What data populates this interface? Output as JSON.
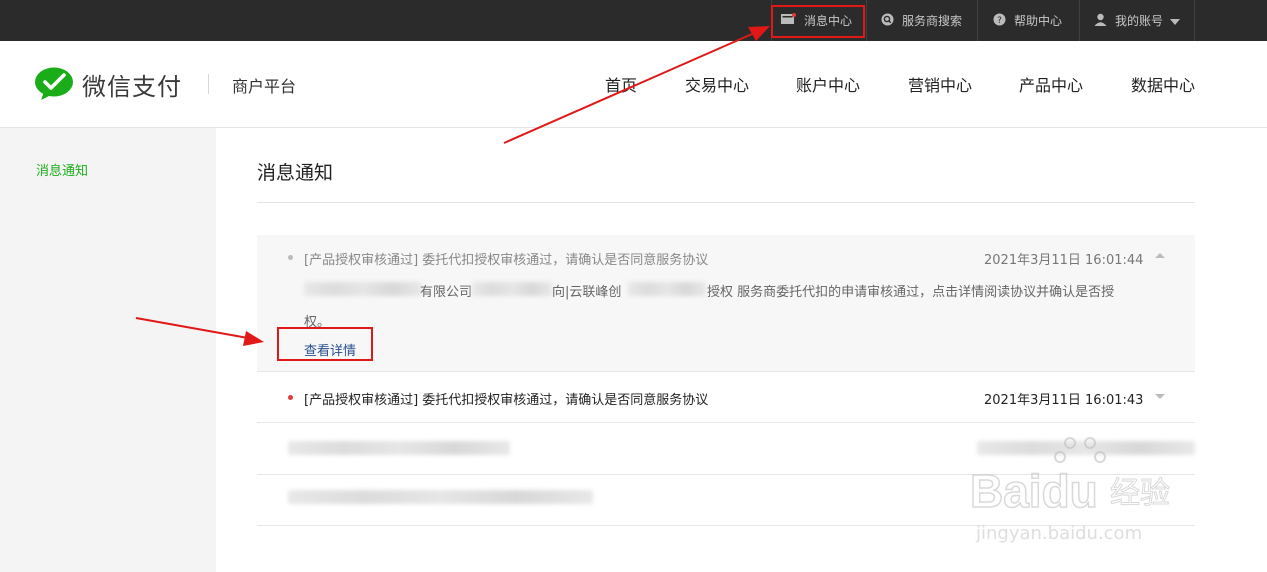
{
  "topbar": {
    "message_center": "消息中心",
    "provider_search": "服务商搜索",
    "help_center": "帮助中心",
    "my_account": "我的账号"
  },
  "brand": {
    "name": "微信支付",
    "subtitle": "商户平台",
    "accent": "#1aad19"
  },
  "nav": [
    "首页",
    "交易中心",
    "账户中心",
    "营销中心",
    "产品中心",
    "数据中心"
  ],
  "sidebar": {
    "items": [
      {
        "label": "消息通知"
      }
    ]
  },
  "main": {
    "title": "消息通知"
  },
  "messages": [
    {
      "title": "[产品授权审核通过] 委托代扣授权审核通过，请确认是否同意服务协议",
      "time": "2021年3月11日 16:01:44",
      "body_part1": "有限公司",
      "body_part2": "向|云联峰创",
      "body_part3": "授权 服务商委托代扣的申请审核通过，点击详情阅读协议并确认是否授",
      "body_line2": "权。",
      "detail_link": "查看详情",
      "expanded": true,
      "unread": false
    },
    {
      "title": "[产品授权审核通过] 委托代扣授权审核通过，请确认是否同意服务协议",
      "time": "2021年3月11日 16:01:43",
      "expanded": false,
      "unread": true
    }
  ],
  "watermark": {
    "brand": "Baidu经验",
    "url": "jingyan.baidu.com"
  },
  "colors": {
    "annotation_red": "#e01818",
    "unread_dot": "#e03c3c",
    "link_blue": "#2a4f8f"
  }
}
